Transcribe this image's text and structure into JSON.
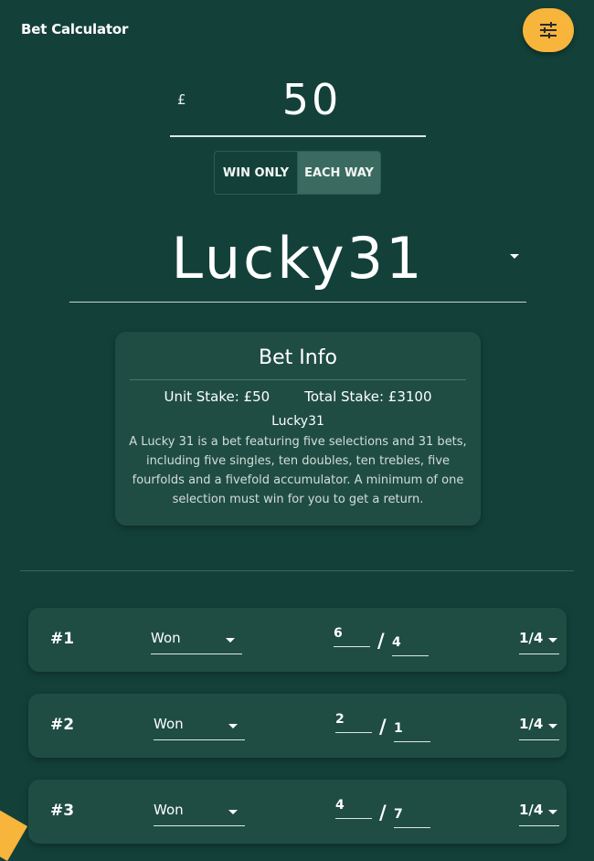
{
  "header": {
    "title": "Bet Calculator",
    "settings_icon": "sliders-icon"
  },
  "stake": {
    "currency_symbol": "£",
    "value": "50"
  },
  "toggle": {
    "win_only_label": "WIN ONLY",
    "each_way_label": "EACH WAY",
    "selected": "EACH WAY"
  },
  "bet_type": {
    "value": "Lucky31"
  },
  "bet_info": {
    "title": "Bet Info",
    "unit_stake": "Unit Stake: £50",
    "total_stake": "Total Stake: £3100",
    "name": "Lucky31",
    "description": "A Lucky 31 is a bet featuring five selections and 31 bets, including five singles, ten doubles, ten trebles, five fourfolds and a fivefold accumulator. A minimum of one selection must win for you to get a return."
  },
  "selections": [
    {
      "label": "#1",
      "result": "Won",
      "odds_num": "6",
      "odds_den": "4",
      "each_way_terms": "1/4"
    },
    {
      "label": "#2",
      "result": "Won",
      "odds_num": "2",
      "odds_den": "1",
      "each_way_terms": "1/4"
    },
    {
      "label": "#3",
      "result": "Won",
      "odds_num": "4",
      "odds_den": "7",
      "each_way_terms": "1/4"
    }
  ],
  "colors": {
    "background": "#13413a",
    "card": "#1f4d44",
    "accent": "#f7b53b",
    "toggle_active": "#3b6b60"
  }
}
